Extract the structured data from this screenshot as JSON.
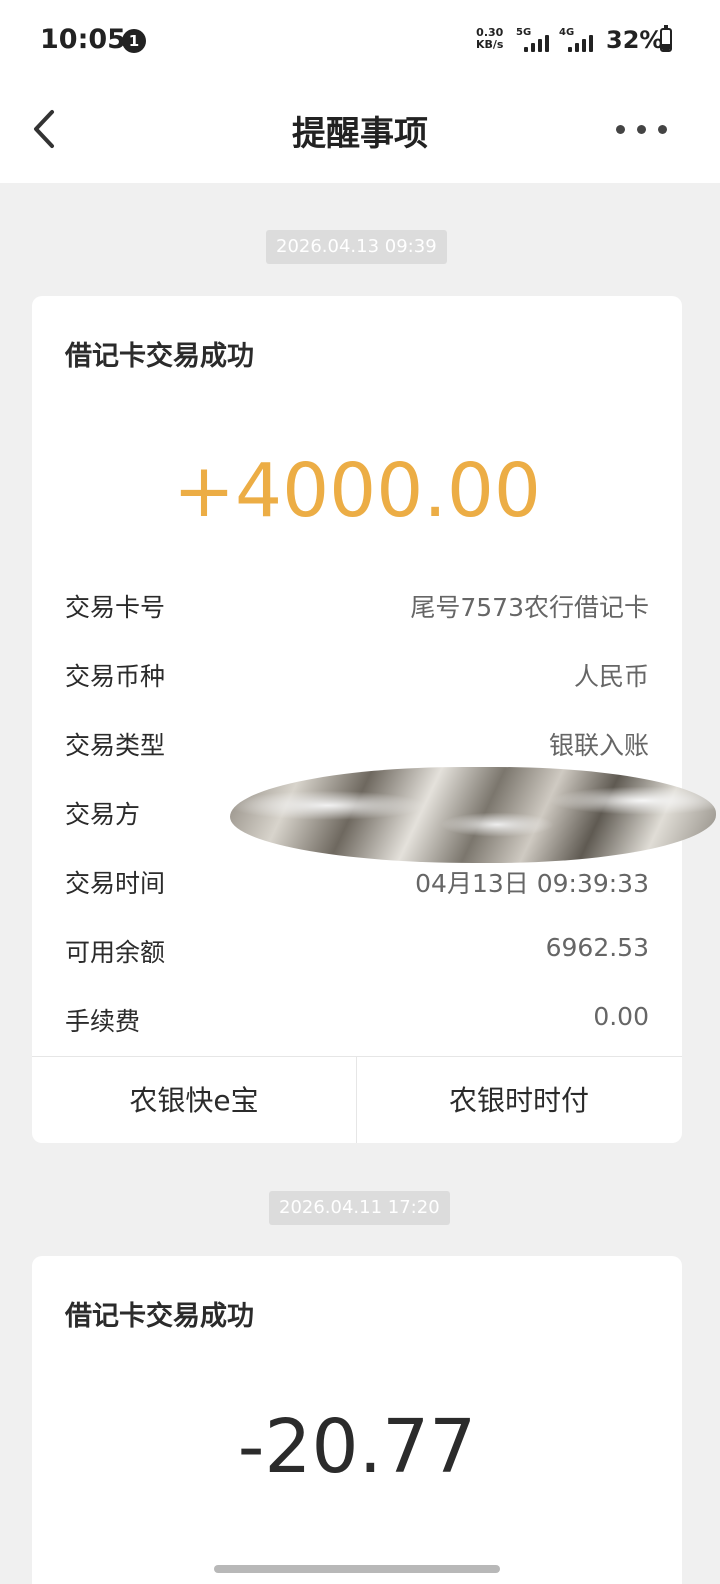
{
  "status_bar": {
    "time": "10:05",
    "notification_count": "1",
    "net_speed_value": "0.30",
    "net_speed_unit": "KB/s",
    "signal_1_label": "5G",
    "signal_2_label": "4G",
    "battery_text": "32%",
    "battery_level": 0.32
  },
  "header": {
    "title": "提醒事项",
    "back_icon": "chevron-left-icon",
    "more_icon": "more-horizontal-icon"
  },
  "messages": [
    {
      "timestamp": "2026.04.13 09:39",
      "title": "借记卡交易成功",
      "amount": "+4000.00",
      "amount_color": "#ecad45",
      "details": [
        {
          "label": "交易卡号",
          "value": "尾号7573农行借记卡"
        },
        {
          "label": "交易币种",
          "value": "人民币"
        },
        {
          "label": "交易类型",
          "value": "银联入账"
        },
        {
          "label": "交易方",
          "value": ""
        },
        {
          "label": "交易时间",
          "value": "04月13日 09:39:33"
        },
        {
          "label": "可用余额",
          "value": "6962.53"
        },
        {
          "label": "手续费",
          "value": "0.00"
        }
      ],
      "actions": [
        "农银快e宝",
        "农银时时付"
      ]
    },
    {
      "timestamp": "2026.04.11 17:20",
      "title": "借记卡交易成功",
      "amount": "-20.77",
      "amount_color": "#2b2b2b"
    }
  ]
}
